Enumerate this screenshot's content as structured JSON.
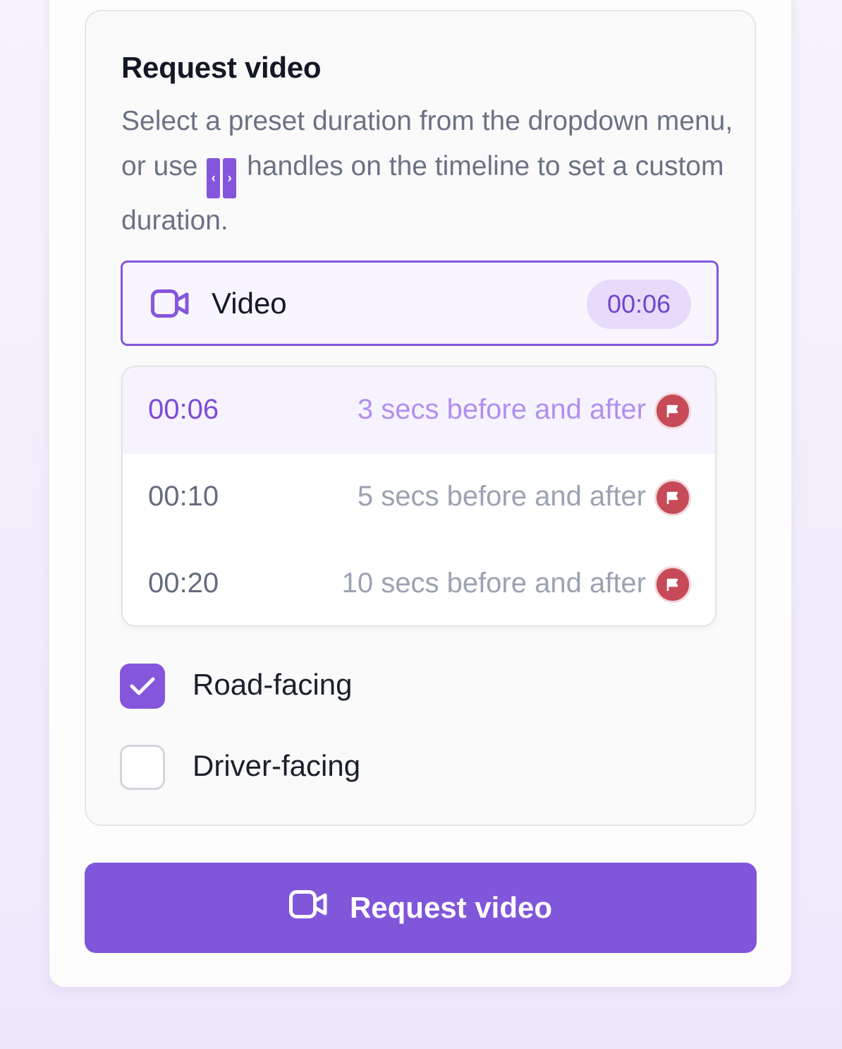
{
  "panel": {
    "title": "Request video",
    "description_before": "Select a preset duration from the dropdown menu, or use",
    "description_after": "handles on the timeline to set a custom duration.",
    "handle_left_glyph": "‹",
    "handle_right_glyph": "›"
  },
  "select": {
    "icon": "video-camera-icon",
    "label": "Video",
    "value": "00:06"
  },
  "dropdown": {
    "options": [
      {
        "time": "00:06",
        "description": "3 secs before and after",
        "icon": "flag-icon",
        "active": true
      },
      {
        "time": "00:10",
        "description": "5 secs before and after",
        "icon": "flag-icon",
        "active": false
      },
      {
        "time": "00:20",
        "description": "10 secs before and after",
        "icon": "flag-icon",
        "active": false
      }
    ]
  },
  "cameras": [
    {
      "label": "Road-facing",
      "checked": true
    },
    {
      "label": "Driver-facing",
      "checked": false
    }
  ],
  "action": {
    "icon": "video-camera-icon",
    "label": "Request video"
  },
  "colors": {
    "accent": "#8056da",
    "flag": "#c64a58",
    "pill_bg": "#e7dbfb"
  }
}
